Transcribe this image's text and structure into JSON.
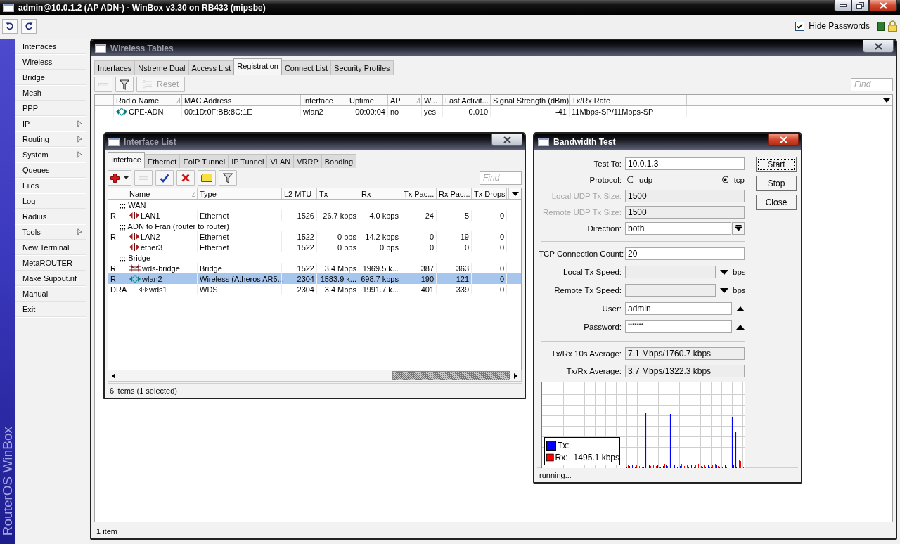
{
  "app": {
    "title": "admin@10.0.1.2 (AP ADN-) - WinBox v3.30 on RB433 (mipsbe)",
    "hide_passwords": {
      "label": "Hide Passwords",
      "checked": true
    }
  },
  "sidebar": {
    "brand": "RouterOS WinBox",
    "items": [
      {
        "label": "Interfaces",
        "submenu": false
      },
      {
        "label": "Wireless",
        "submenu": false
      },
      {
        "label": "Bridge",
        "submenu": false
      },
      {
        "label": "Mesh",
        "submenu": false
      },
      {
        "label": "PPP",
        "submenu": false
      },
      {
        "label": "IP",
        "submenu": true
      },
      {
        "label": "Routing",
        "submenu": true
      },
      {
        "label": "System",
        "submenu": true
      },
      {
        "label": "Queues",
        "submenu": false
      },
      {
        "label": "Files",
        "submenu": false
      },
      {
        "label": "Log",
        "submenu": false
      },
      {
        "label": "Radius",
        "submenu": false
      },
      {
        "label": "Tools",
        "submenu": true
      },
      {
        "label": "New Terminal",
        "submenu": false
      },
      {
        "label": "MetaROUTER",
        "submenu": false
      },
      {
        "label": "Make Supout.rif",
        "submenu": false
      },
      {
        "label": "Manual",
        "submenu": false
      },
      {
        "label": "Exit",
        "submenu": false
      }
    ]
  },
  "wireless_tables": {
    "title": "Wireless Tables",
    "active": false,
    "tabs": [
      {
        "label": "Interfaces",
        "selected": false
      },
      {
        "label": "Nstreme Dual",
        "selected": false
      },
      {
        "label": "Access List",
        "selected": false
      },
      {
        "label": "Registration",
        "selected": true
      },
      {
        "label": "Connect List",
        "selected": false
      },
      {
        "label": "Security Profiles",
        "selected": false
      }
    ],
    "toolbar": [
      {
        "kind": "remove",
        "disabled": true
      },
      {
        "kind": "filter",
        "disabled": false
      },
      {
        "kind": "reset",
        "label": "Reset",
        "disabled": true
      }
    ],
    "find": {
      "placeholder": "Find"
    },
    "columns": [
      {
        "label": "Radio Name",
        "sorted": true
      },
      {
        "label": "MAC Address",
        "sorted": false
      },
      {
        "label": "Interface",
        "sorted": false
      },
      {
        "label": "Uptime",
        "sorted": false
      },
      {
        "label": "AP",
        "sorted": true
      },
      {
        "label": "W...",
        "sorted": false
      },
      {
        "label": "Last Activit...",
        "sorted": false
      },
      {
        "label": "Signal Strength (dBm)",
        "sorted": false
      },
      {
        "label": "Tx/Rx Rate",
        "sorted": false
      }
    ],
    "rows": [
      {
        "kind": "wireless",
        "selected": false,
        "cells": [
          "CPE-ADN",
          "00:1D:0F:BB:8C:1E",
          "wlan2",
          "00:00:04",
          "no",
          "yes",
          "0.010",
          "-41",
          "11Mbps-SP/11Mbps-SP"
        ]
      }
    ],
    "status": "1 item"
  },
  "interface_list": {
    "title": "Interface List",
    "active": false,
    "tabs": [
      {
        "label": "Interface",
        "selected": true
      },
      {
        "label": "Ethernet",
        "selected": false
      },
      {
        "label": "EoIP Tunnel",
        "selected": false
      },
      {
        "label": "IP Tunnel",
        "selected": false
      },
      {
        "label": "VLAN",
        "selected": false
      },
      {
        "label": "VRRP",
        "selected": false
      },
      {
        "label": "Bonding",
        "selected": false
      }
    ],
    "toolbar": [
      {
        "kind": "add",
        "disabled": false
      },
      {
        "kind": "remove",
        "disabled": true
      },
      {
        "kind": "enable",
        "disabled": false
      },
      {
        "kind": "disable",
        "disabled": false
      },
      {
        "kind": "comment",
        "disabled": false
      },
      {
        "kind": "filter",
        "disabled": false
      }
    ],
    "find": {
      "placeholder": "Find"
    },
    "columns": [
      {
        "label": "Name",
        "sorted": true
      },
      {
        "label": "Type",
        "sorted": false
      },
      {
        "label": "L2 MTU",
        "sorted": false
      },
      {
        "label": "Tx",
        "sorted": false
      },
      {
        "label": "Rx",
        "sorted": false
      },
      {
        "label": "Tx Pac...",
        "sorted": false
      },
      {
        "label": "Rx Pac...",
        "sorted": false
      },
      {
        "label": "Tx Drops",
        "sorted": false
      }
    ],
    "rows": [
      {
        "kind": "comment",
        "text": ";;; WAN",
        "selected": false
      },
      {
        "kind": "ethernet",
        "flags": "R",
        "name": "LAN1",
        "cells": [
          "Ethernet",
          "1526",
          "26.7 kbps",
          "4.0 kbps",
          "24",
          "5",
          "0"
        ],
        "selected": false
      },
      {
        "kind": "comment",
        "text": ";;; ADN to Fran (router to router)",
        "selected": false
      },
      {
        "kind": "ethernet",
        "flags": "R",
        "name": "LAN2",
        "cells": [
          "Ethernet",
          "1522",
          "0 bps",
          "14.2 kbps",
          "0",
          "19",
          "0"
        ],
        "selected": false
      },
      {
        "kind": "ethernet",
        "name": "ether3",
        "cells": [
          "Ethernet",
          "1522",
          "0 bps",
          "0 bps",
          "0",
          "0",
          "0"
        ],
        "selected": false
      },
      {
        "kind": "comment",
        "text": ";;; Bridge",
        "selected": false
      },
      {
        "kind": "bridge",
        "flags": "R",
        "name": "wds-bridge",
        "cells": [
          "Bridge",
          "1522",
          "3.4 Mbps",
          "1969.5 k...",
          "387",
          "363",
          "0"
        ],
        "selected": false
      },
      {
        "kind": "wireless",
        "flags": "R",
        "name": "wlan2",
        "cells": [
          "Wireless (Atheros AR5...",
          "2304",
          "1583.9 k...",
          "698.7 kbps",
          "190",
          "121",
          "0"
        ],
        "selected": true,
        "children": [
          {
            "kind": "wds",
            "flags": "DRA",
            "name": "wds1",
            "cells": [
              "WDS",
              "2304",
              "3.4 Mbps",
              "1991.7 k...",
              "401",
              "339",
              "0"
            ],
            "selected": false
          }
        ]
      }
    ],
    "status": "6 items (1 selected)"
  },
  "bandwidth_test": {
    "title": "Bandwidth Test",
    "active": true,
    "sections": [
      {
        "fields": [
          {
            "kind": "text",
            "label": "Test To:",
            "value": "10.0.1.3",
            "disabled": false
          },
          {
            "kind": "radio",
            "label": "Protocol:",
            "options": [
              {
                "label": "udp",
                "selected": false
              },
              {
                "label": "tcp",
                "selected": true
              }
            ],
            "disabled": false
          },
          {
            "kind": "text",
            "label": "Local UDP Tx Size:",
            "value": "1500",
            "disabled": true
          },
          {
            "kind": "text",
            "label": "Remote UDP Tx Size:",
            "value": "1500",
            "disabled": true
          },
          {
            "kind": "select",
            "label": "Direction:",
            "value": "both",
            "disabled": false
          }
        ]
      },
      {
        "fields": [
          {
            "kind": "text",
            "label": "TCP Connection Count:",
            "value": "20",
            "disabled": false
          },
          {
            "kind": "speed",
            "label": "Local Tx Speed:",
            "unit": "bps",
            "disabled": false
          },
          {
            "kind": "speed",
            "label": "Remote Tx Speed:",
            "unit": "bps",
            "disabled": false
          },
          {
            "kind": "history",
            "label": "User:",
            "value": "admin",
            "disabled": false
          },
          {
            "kind": "password",
            "label": "Password:",
            "value": "*******",
            "disabled": false
          }
        ]
      },
      {
        "fields": [
          {
            "kind": "readonly",
            "label": "Tx/Rx 10s Average:",
            "value": "7.1 Mbps/1760.7 kbps",
            "disabled": false
          },
          {
            "kind": "readonly",
            "label": "Tx/Rx Average:",
            "value": "3.7 Mbps/1322.3 kbps",
            "disabled": false
          }
        ]
      }
    ],
    "legend": [
      {
        "label": "Tx:",
        "color": "#0000ff"
      },
      {
        "label": "Rx:",
        "value": "1495.1 kbps",
        "color": "#ff0000"
      }
    ],
    "buttons": [
      {
        "label": "Start",
        "focused": true
      },
      {
        "label": "Stop",
        "focused": false
      },
      {
        "label": "Close",
        "focused": false
      }
    ],
    "status": "running..."
  }
}
